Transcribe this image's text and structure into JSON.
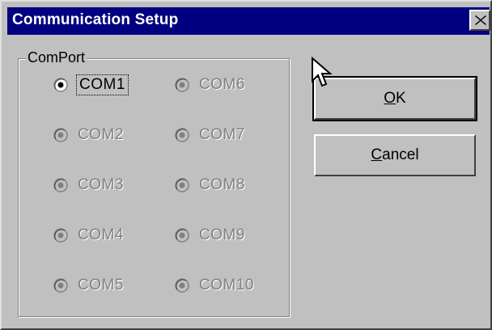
{
  "window": {
    "title": "Communication Setup"
  },
  "group": {
    "label": "ComPort"
  },
  "ports": [
    {
      "label": "COM1",
      "selected": true,
      "enabled": true
    },
    {
      "label": "COM2",
      "selected": false,
      "enabled": false
    },
    {
      "label": "COM3",
      "selected": false,
      "enabled": false
    },
    {
      "label": "COM4",
      "selected": false,
      "enabled": false
    },
    {
      "label": "COM5",
      "selected": false,
      "enabled": false
    },
    {
      "label": "COM6",
      "selected": false,
      "enabled": false
    },
    {
      "label": "COM7",
      "selected": false,
      "enabled": false
    },
    {
      "label": "COM8",
      "selected": false,
      "enabled": false
    },
    {
      "label": "COM9",
      "selected": false,
      "enabled": false
    },
    {
      "label": "COM10",
      "selected": false,
      "enabled": false
    }
  ],
  "buttons": {
    "ok": {
      "accel": "O",
      "rest": "K"
    },
    "cancel": {
      "accel": "C",
      "rest": "ancel"
    }
  },
  "icons": {
    "close": "close-icon",
    "cursor": "mouse-pointer-icon"
  },
  "colors": {
    "titlebar": "#000080",
    "face": "#c0c0c0",
    "disabled_text": "#808080"
  }
}
